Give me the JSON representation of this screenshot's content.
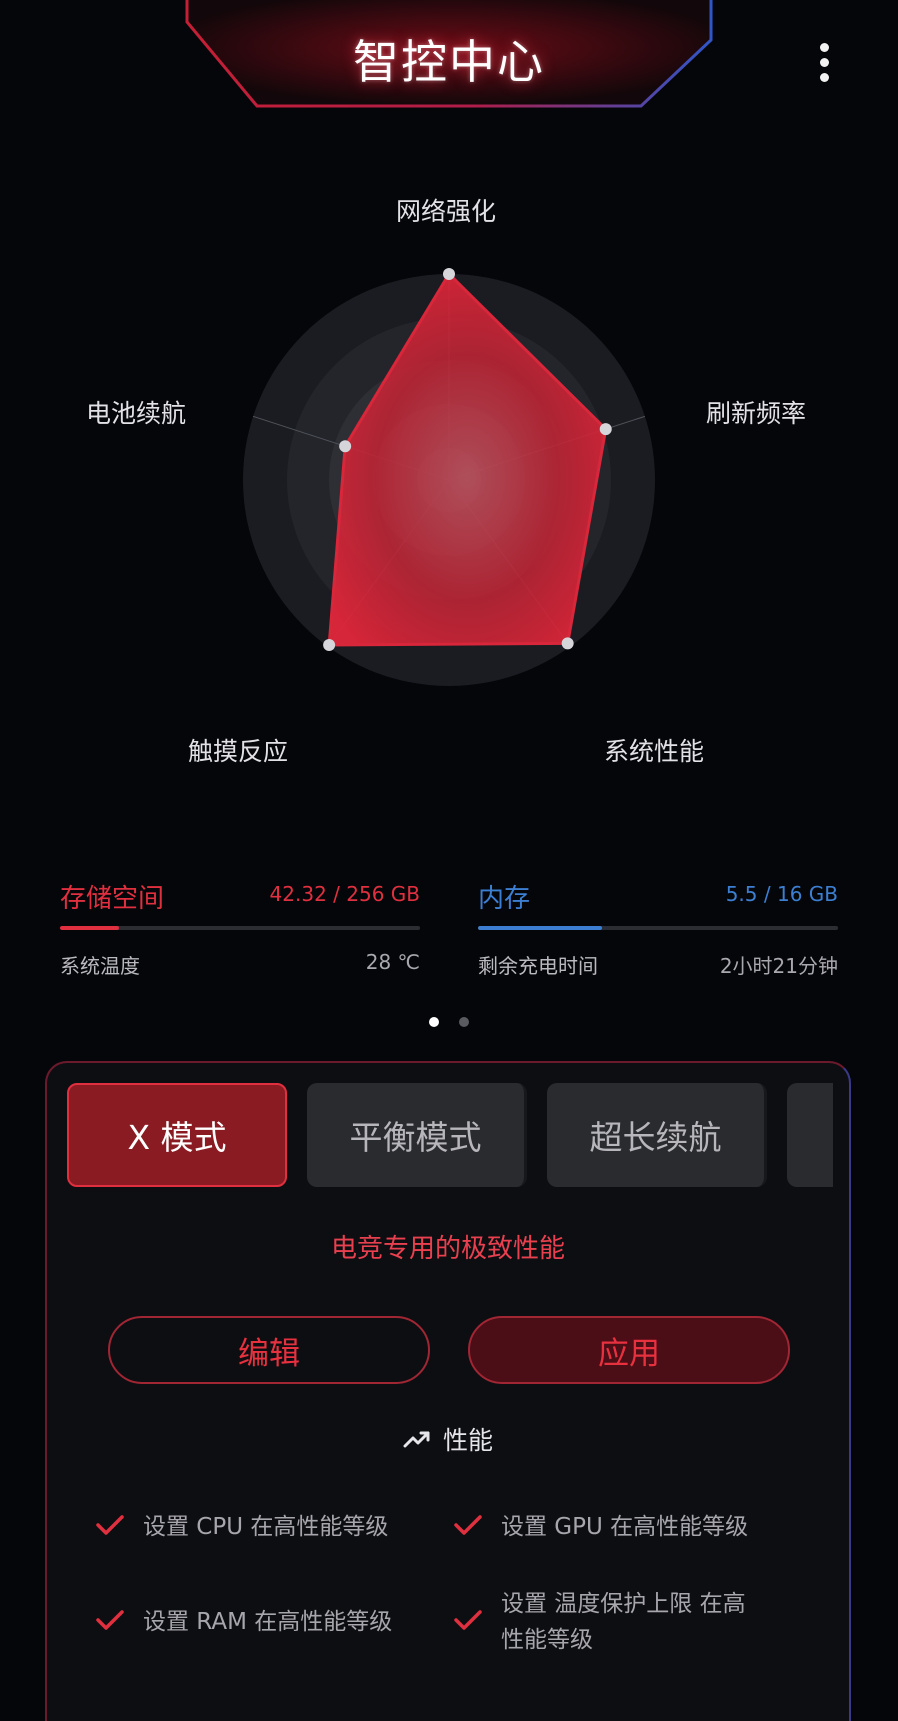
{
  "header": {
    "title": "智控中心"
  },
  "radar": {
    "axes": [
      {
        "label": "网络强化",
        "value": 1.0
      },
      {
        "label": "刷新频率",
        "value": 0.8
      },
      {
        "label": "系统性能",
        "value": 0.98
      },
      {
        "label": "触摸反应",
        "value": 0.99
      },
      {
        "label": "电池续航",
        "value": 0.53
      }
    ],
    "fill_color": "#d8263a",
    "max": 1.0
  },
  "stats": {
    "storage": {
      "label": "存储空间",
      "value": "42.32 / 256 GB",
      "fraction": 0.165,
      "color": "#e0303f"
    },
    "memory": {
      "label": "内存",
      "value": "5.5 / 16 GB",
      "fraction": 0.344,
      "color": "#3c7fd2"
    },
    "temperature": {
      "label": "系统温度",
      "value": "28 ℃"
    },
    "charge_time": {
      "label": "剩余充电时间",
      "value": "2小时21分钟"
    }
  },
  "pager": {
    "pages": 2,
    "active": 0
  },
  "modes": {
    "tabs": [
      {
        "label": "X 模式",
        "active": true
      },
      {
        "label": "平衡模式",
        "active": false
      },
      {
        "label": "超长续航",
        "active": false
      },
      {
        "label": "",
        "active": false
      }
    ],
    "description": "电竞专用的极致性能",
    "edit_label": "编辑",
    "apply_label": "应用",
    "section_title": "性能",
    "features": [
      "设置 CPU 在高性能等级",
      "设置 GPU 在高性能等级",
      "设置 RAM 在高性能等级",
      "设置 温度保护上限 在高性能等级"
    ]
  }
}
